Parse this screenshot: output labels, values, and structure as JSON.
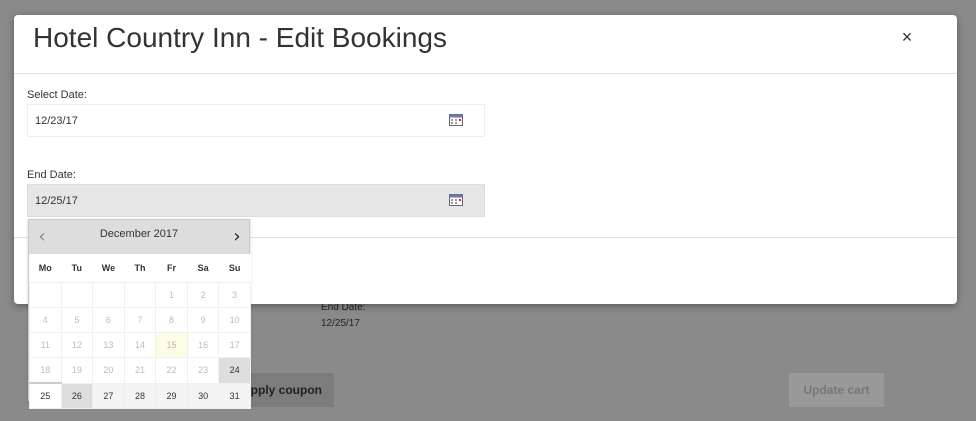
{
  "background": {
    "end_date_label": "End Date:",
    "end_date_value": "12/25/17",
    "apply_coupon_label": "Apply coupon",
    "update_cart_label": "Update cart"
  },
  "modal": {
    "title": "Hotel Country Inn - Edit Bookings",
    "close_label": "×",
    "select_date_label": "Select Date:",
    "select_date_value": "12/23/17",
    "end_date_label": "End Date:",
    "end_date_value": "12/25/17"
  },
  "datepicker": {
    "title": "December 2017",
    "prev_label": "‹",
    "next_label": "›",
    "weekdays": [
      "Mo",
      "Tu",
      "We",
      "Th",
      "Fr",
      "Sa",
      "Su"
    ],
    "weeks": [
      [
        "",
        "",
        "",
        "",
        "1",
        "2",
        "3"
      ],
      [
        "4",
        "5",
        "6",
        "7",
        "8",
        "9",
        "10"
      ],
      [
        "11",
        "12",
        "13",
        "14",
        "15",
        "16",
        "17"
      ],
      [
        "18",
        "19",
        "20",
        "21",
        "22",
        "23",
        "24"
      ],
      [
        "25",
        "26",
        "27",
        "28",
        "29",
        "30",
        "31"
      ]
    ],
    "today": "15",
    "selected_start": "25",
    "highlighted": [
      "24",
      "26"
    ],
    "first_selectable": "24"
  },
  "colors": {
    "overlay": "#8a8a8a",
    "modal_bg": "#ffffff",
    "header_bg": "#dddddd",
    "today_bg": "#fdfde5"
  }
}
